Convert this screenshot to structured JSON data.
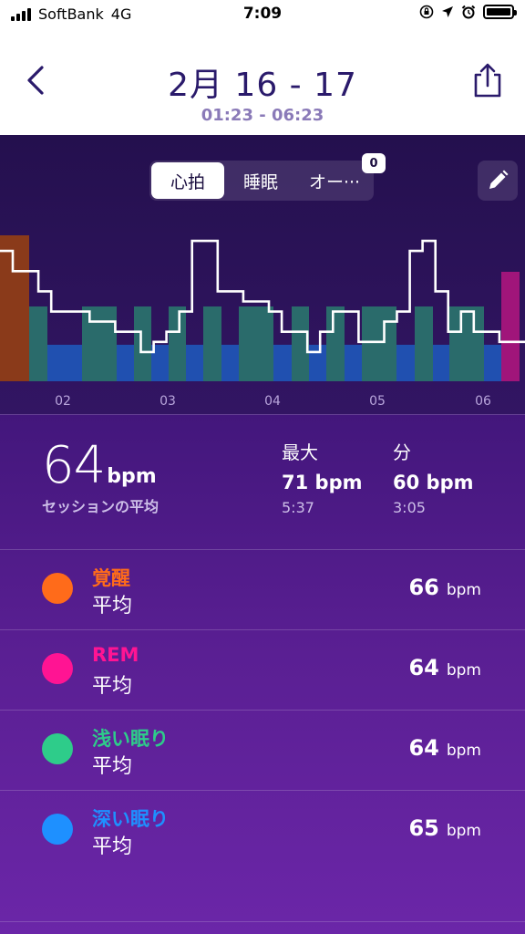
{
  "status": {
    "carrier": "SoftBank",
    "network": "4G",
    "time": "7:09"
  },
  "header": {
    "title": "2月 16 - 17",
    "subtitle": "01:23 - 06:23",
    "back_icon": "chevron-left-icon",
    "share_icon": "share-icon"
  },
  "tabs": {
    "items": [
      "心拍",
      "睡眠",
      "オー···"
    ],
    "active": "心拍",
    "badge": "0"
  },
  "chart_data": {
    "type": "line",
    "x_ticks": [
      "02",
      "03",
      "04",
      "05",
      "06"
    ],
    "background_bands": [
      {
        "stage": "awake",
        "color": "#8a3a1a"
      },
      {
        "stage": "rem",
        "color": "#a0157a"
      },
      {
        "stage": "light",
        "color": "#2a6b6b"
      },
      {
        "stage": "deep",
        "color": "#2050b0"
      }
    ],
    "heart_rate_series": [
      70,
      68,
      68,
      66,
      64,
      64,
      64,
      63,
      63,
      62,
      62,
      60,
      61,
      62,
      64,
      71,
      71,
      66,
      66,
      65,
      65,
      64,
      62,
      62,
      60,
      62,
      64,
      64,
      61,
      61,
      63,
      64,
      70,
      71,
      66,
      62,
      64,
      62,
      62,
      61,
      61
    ]
  },
  "summary": {
    "avg_value": "64",
    "avg_unit": "bpm",
    "avg_label": "セッションの平均",
    "max_label": "最大",
    "max_value": "71 bpm",
    "max_time": "5:37",
    "min_label": "分",
    "min_value": "60 bpm",
    "min_time": "3:05"
  },
  "stages": [
    {
      "name": "覚醒",
      "sub": "平均",
      "value": "66",
      "unit": "bpm",
      "color": "#ff6b1a"
    },
    {
      "name": "REM",
      "sub": "平均",
      "value": "64",
      "unit": "bpm",
      "color": "#ff1493"
    },
    {
      "name": "浅い眠り",
      "sub": "平均",
      "value": "64",
      "unit": "bpm",
      "color": "#2ecc8a"
    },
    {
      "name": "深い眠り",
      "sub": "平均",
      "value": "65",
      "unit": "bpm",
      "color": "#1e90ff"
    }
  ]
}
